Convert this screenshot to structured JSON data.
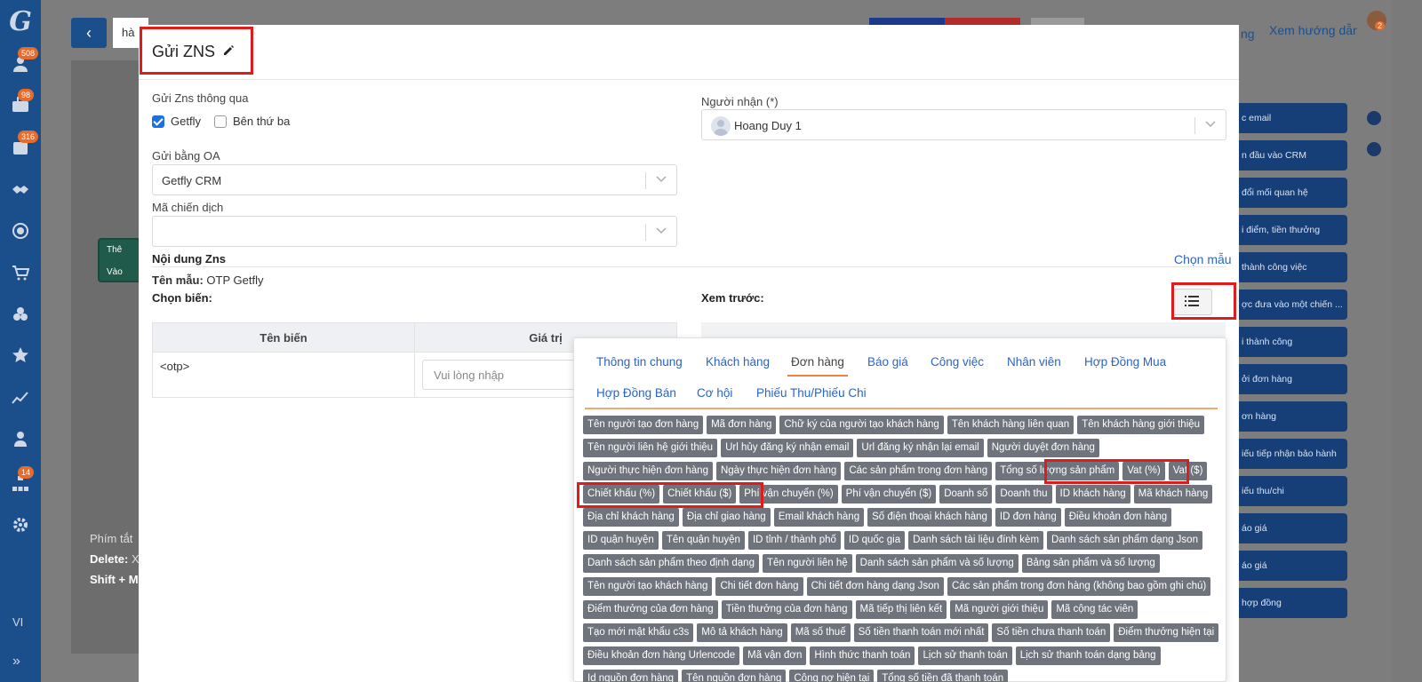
{
  "sidebar": {
    "logo": "G",
    "badges": [
      "508",
      "98",
      "316",
      "14"
    ],
    "language": "VI"
  },
  "background": {
    "search_text": "hà",
    "node_label_top": "Thê",
    "node_label_bottom": "Vào",
    "shortcut_title": "Phím tắt",
    "shortcut_delete": "Delete:",
    "shortcut_delete_suffix": "X",
    "shortcut_shift": "Shift + M",
    "link_partial": "ng",
    "guide_link": "Xem hướng dẫn",
    "right_items": [
      "c email",
      "n đầu vào CRM",
      "đổi mối quan hệ",
      "i điểm, tiền thưởng",
      "thành công việc",
      "ợc đưa vào một chiến ...",
      "i thành công",
      "ởi đơn hàng",
      "ơn hàng",
      "iếu tiếp nhận bảo hành",
      "iếu thu/chi",
      "áo giá",
      "áo giá",
      "hợp đồng"
    ],
    "top_right_badge": "2"
  },
  "modal": {
    "title": "Gửi ZNS",
    "send_via_label": "Gửi Zns thông qua",
    "options": [
      "Getfly",
      "Bên thứ ba"
    ],
    "oa_label": "Gửi bằng OA",
    "oa_value": "Getfly CRM",
    "campaign_label": "Mã chiến dịch",
    "campaign_value": "",
    "recipient_label": "Người nhận (*)",
    "recipient_value": "Hoang Duy 1",
    "content_title": "Nội dung Zns",
    "choose_template_link": "Chọn mẫu",
    "template_label": "Tên mẫu:",
    "template_name": "OTP Getfly",
    "choose_var_label": "Chọn biến:",
    "preview_label": "Xem trước:",
    "table": {
      "headers": [
        "Tên biến",
        "Giá trị"
      ],
      "row_var": "<otp>",
      "row_placeholder": "Vui lòng nhập"
    }
  },
  "picker": {
    "tabs": [
      "Thông tin chung",
      "Khách hàng",
      "Đơn hàng",
      "Báo giá",
      "Công việc",
      "Nhân viên",
      "Hợp Đồng Mua",
      "Hợp Đồng Bán",
      "Cơ hội",
      "Phiếu Thu/Phiếu Chi"
    ],
    "active_tab": "Đơn hàng",
    "chips": [
      "Tên người tạo đơn hàng",
      "Mã đơn hàng",
      "Chữ ký của người tạo khách hàng",
      "Tên khách hàng liên quan",
      "Tên khách hàng giới thiệu",
      "Tên người liên hệ giới thiệu",
      "Url hủy đăng ký nhận email",
      "Url đăng ký nhận lại email",
      "Người duyệt đơn hàng",
      "Người thực hiện đơn hàng",
      "Ngày thực hiện đơn hàng",
      "Các sản phẩm trong đơn hàng",
      "Tổng số lượng sản phẩm",
      "Vat (%)",
      "Vat ($)",
      "Chiết khấu (%)",
      "Chiết khấu ($)",
      "Phí vận chuyển (%)",
      "Phí vận chuyển ($)",
      "Doanh số",
      "Doanh thu",
      "ID khách hàng",
      "Mã khách hàng",
      "Địa chỉ khách hàng",
      "Địa chỉ giao hàng",
      "Email khách hàng",
      "Số điện thoại khách hàng",
      "ID đơn hàng",
      "Điều khoản đơn hàng",
      "ID quận huyện",
      "Tên quận huyện",
      "ID tỉnh / thành phố",
      "ID quốc gia",
      "Danh sách tài liệu đính kèm",
      "Danh sách sản phẩm dạng Json",
      "Danh sách sản phẩm theo định dạng",
      "Tên người liên hệ",
      "Danh sách sản phẩm và số lượng",
      "Bảng sản phẩm và số lượng",
      "Tên người tạo khách hàng",
      "Chi tiết đơn hàng",
      "Chi tiết đơn hàng dạng Json",
      "Các sản phẩm trong đơn hàng (không bao gồm ghi chú)",
      "Điểm thưởng của đơn hàng",
      "Tiền thưởng của đơn hàng",
      "Mã tiếp thị liên kết",
      "Mã người giới thiệu",
      "Mã cộng tác viên",
      "Tạo mới mật khẩu c3s",
      "Mô tả khách hàng",
      "Mã số thuế",
      "Số tiền thanh toán mới nhất",
      "Số tiền chưa thanh toán",
      "Điểm thưởng hiện tại",
      "Điều khoản đơn hàng Urlencode",
      "Mã vận đơn",
      "Hình thức thanh toán",
      "Lịch sử thanh toán",
      "Lịch sử thanh toán dạng bảng",
      "Id nguồn đơn hàng",
      "Tên nguồn đơn hàng",
      "Công nợ hiện tại",
      "Tổng số tiền đã thanh toán"
    ]
  }
}
